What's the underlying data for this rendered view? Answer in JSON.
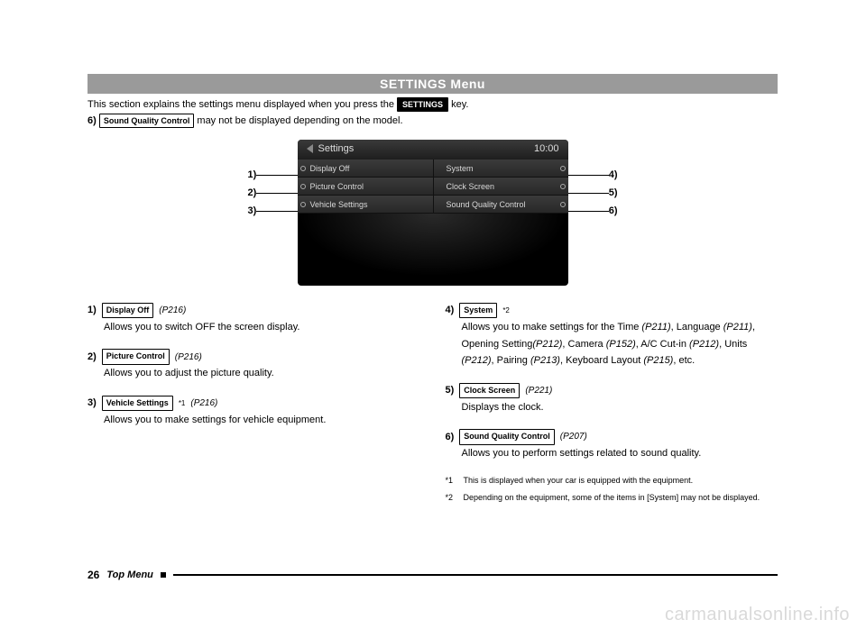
{
  "banner": "SETTINGS Menu",
  "intro": {
    "line1_a": "This section explains the settings menu displayed when you press the",
    "settings_key": "SETTINGS",
    "line1_b": "key.",
    "line2_num": "6)",
    "line2_key": "Sound Quality Control",
    "line2_rest": " may not be displayed depending on the model."
  },
  "device": {
    "title": "Settings",
    "clock": "10:00",
    "left": [
      "Display Off",
      "Picture Control",
      "Vehicle Settings"
    ],
    "right": [
      "System",
      "Clock Screen",
      "Sound Quality Control"
    ]
  },
  "callouts": {
    "l1": "1)",
    "l2": "2)",
    "l3": "3)",
    "r1": "4)",
    "r2": "5)",
    "r3": "6)"
  },
  "items_left": [
    {
      "num": "1)",
      "key": "Display Off",
      "ref": "(P216)",
      "sup": "",
      "body": "Allows you to switch OFF the screen display."
    },
    {
      "num": "2)",
      "key": "Picture Control",
      "ref": "(P216)",
      "sup": "",
      "body": "Allows you to adjust the picture quality."
    },
    {
      "num": "3)",
      "key": "Vehicle Settings",
      "ref": "(P216)",
      "sup": "*1",
      "body": "Allows you to make settings for vehicle equipment."
    }
  ],
  "items_right": [
    {
      "num": "4)",
      "key": "System",
      "ref": "",
      "sup": "*2",
      "body_html": "Allows you to make settings for the Time <i>(P211)</i>, Language <i>(P211)</i>, Opening Setting<i>(P212)</i>, Camera <i>(P152)</i>, A/C Cut-in <i>(P212)</i>, Units <i>(P212)</i>, Pairing <i>(P213)</i>, Keyboard Layout <i>(P215)</i>, etc."
    },
    {
      "num": "5)",
      "key": "Clock Screen",
      "ref": "(P221)",
      "sup": "",
      "body_html": "Displays the clock."
    },
    {
      "num": "6)",
      "key": "Sound Quality Control",
      "ref": "(P207)",
      "sup": "",
      "body_html": "Allows you to perform settings related to sound quality."
    }
  ],
  "footnotes": [
    {
      "label": "*1",
      "text": "This is displayed when your car is equipped with the equipment."
    },
    {
      "label": "*2",
      "text": "Depending on the equipment, some of the items in [System] may not be displayed."
    }
  ],
  "footer": {
    "page": "26",
    "section": "Top Menu"
  },
  "watermark": "carmanualsonline.info"
}
